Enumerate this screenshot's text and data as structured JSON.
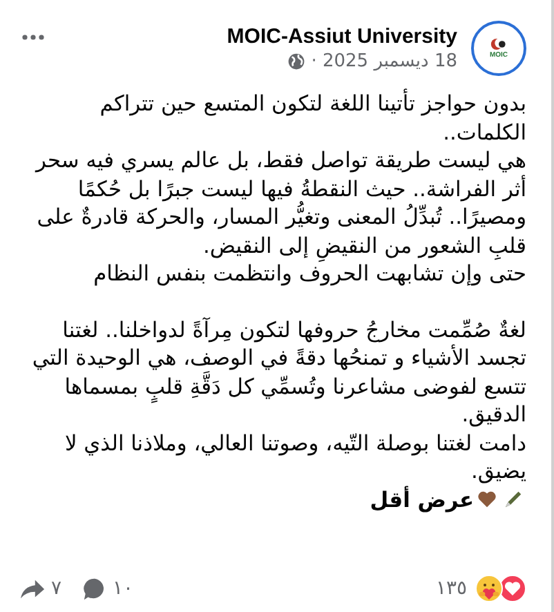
{
  "post": {
    "author": "MOIC-Assiut University",
    "avatar_text": "MOIC",
    "date": "18 ديسمبر 2025 ·",
    "sections": [
      {
        "paragraphs": [
          "بدون حواجز تأتينا اللغة لتكون المتسع حين تتراكم الكلمات..",
          "هي ليست طريقة تواصل فقط، بل عالم يسري فيه سحر أثر الفراشة.. حيث النقطةُ فيها ليست جبرًا بل حُكمًا ومصيرًا.. تُبدِّلُ المعنى وتغيُّر المسار، والحركة قادرةٌ على قلبِ الشعور من النقيضِ إلى النقيض.",
          "حتى وإن تشابهت الحروف وانتظمت بنفس النظام"
        ]
      },
      {
        "paragraphs": [
          "لغةٌ صُمِّمت مخارجُ حروفها لتكون مِرآةً لدواخلنا.. لغتنا تجسد الأشياء و تمنحُها دقةً في الوصف، هي الوحيدة التي تتسع لفوضى مشاعرنا وتُسمِّي كل دَقَّةِ قلبٍ بمسماها الدقيق.",
          "دامت لغتنا بوصلة التّيه، وصوتنا العالي، وملاذنا الذي لا يضيق."
        ]
      }
    ],
    "see_less": "عرض أقل",
    "reactions": [
      {
        "kind": "love"
      },
      {
        "kind": "care"
      }
    ],
    "reaction_count": "١٣٥",
    "comment_count": "١٠",
    "share_count": "٧"
  }
}
